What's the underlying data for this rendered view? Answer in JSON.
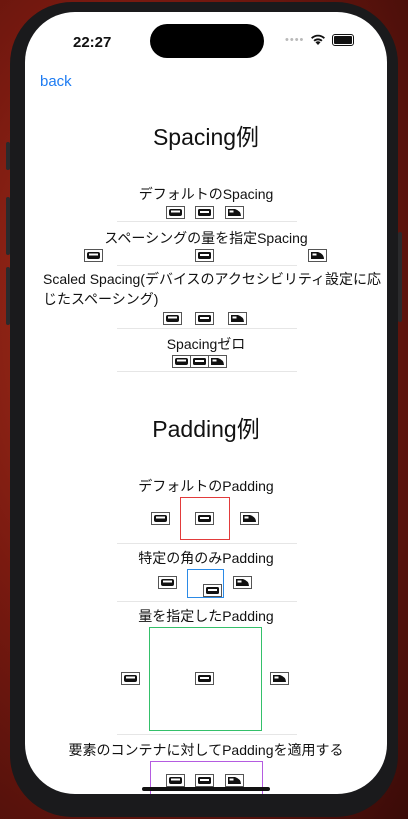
{
  "status_bar": {
    "time": "22:27"
  },
  "nav": {
    "back_label": "back"
  },
  "spacing_section": {
    "title": "Spacing例",
    "rows": [
      {
        "label": "デフォルトのSpacing"
      },
      {
        "label": "スペーシングの量を指定Spacing"
      },
      {
        "label": "Scaled Spacing(デバイスのアクセシビリティ設定に応じたスペーシング)"
      },
      {
        "label": "Spacingゼロ"
      }
    ]
  },
  "padding_section": {
    "title": "Padding例",
    "rows": [
      {
        "label": "デフォルトのPadding",
        "color": "#e23b3b"
      },
      {
        "label": "特定の角のみPadding",
        "color": "#2b8ae6"
      },
      {
        "label": "量を指定したPadding",
        "color": "#34c06a"
      },
      {
        "label": "要素のコンテナに対してPaddingを適用する",
        "color": "#b45be0"
      }
    ]
  },
  "icons": [
    "tram-front-icon",
    "train-front-icon",
    "bullet-train-icon"
  ]
}
